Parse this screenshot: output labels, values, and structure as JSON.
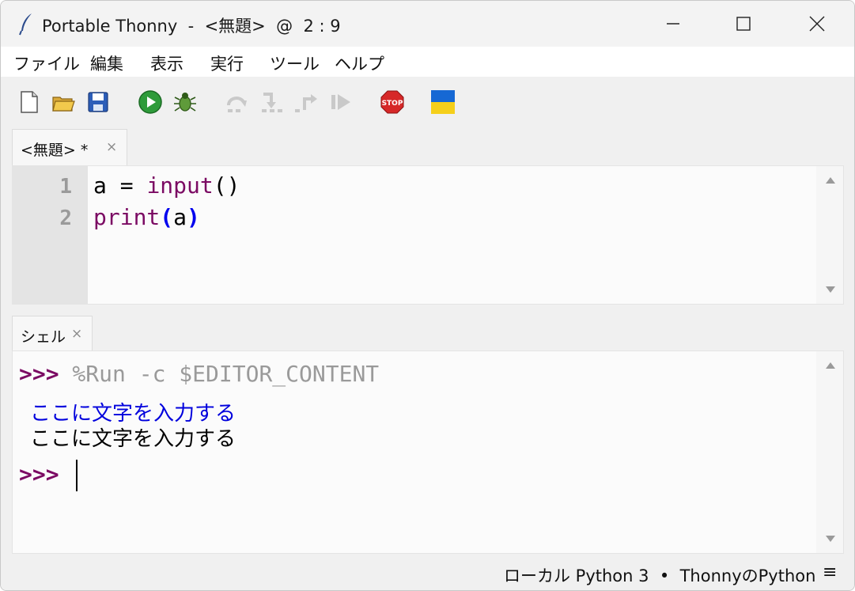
{
  "window": {
    "title": "Portable Thonny  -  <無題>  @  2 : 9"
  },
  "menu": {
    "items": [
      "ファイル",
      "編集",
      "表示",
      "実行",
      "ツール",
      "ヘルプ"
    ]
  },
  "toolbar": {
    "icons": [
      "new-file-icon",
      "open-file-icon",
      "save-icon",
      "run-icon",
      "debug-icon",
      "step-over-icon",
      "step-into-icon",
      "step-out-icon",
      "resume-icon",
      "stop-icon",
      "ukraine-flag-icon"
    ],
    "stop_label": "STOP"
  },
  "editor_tab": {
    "label": "<無題> *",
    "close": "×"
  },
  "editor": {
    "line_numbers": [
      "1",
      "2"
    ],
    "lines": [
      {
        "pre": "a = ",
        "kw": "input",
        "post": "()"
      },
      {
        "kw": "print",
        "open": "(",
        "arg": "a",
        "close": ")"
      }
    ]
  },
  "shell_tab": {
    "label": "シェル",
    "close": "×"
  },
  "shell": {
    "prompt": ">>>",
    "command": " %Run -c $EDITOR_CONTENT",
    "input_echo": "ここに文字を入力する",
    "output": "ここに文字を入力する",
    "prompt2": ">>>"
  },
  "status": {
    "text": "ローカル Python 3  •  ThonnyのPython",
    "menu_glyph": "≡"
  },
  "colors": {
    "keyword": "#7b0a63",
    "bracket": "#0000ee",
    "input_echo": "#0000dd",
    "stop_red": "#d62828",
    "run_green": "#2e9b3a"
  }
}
